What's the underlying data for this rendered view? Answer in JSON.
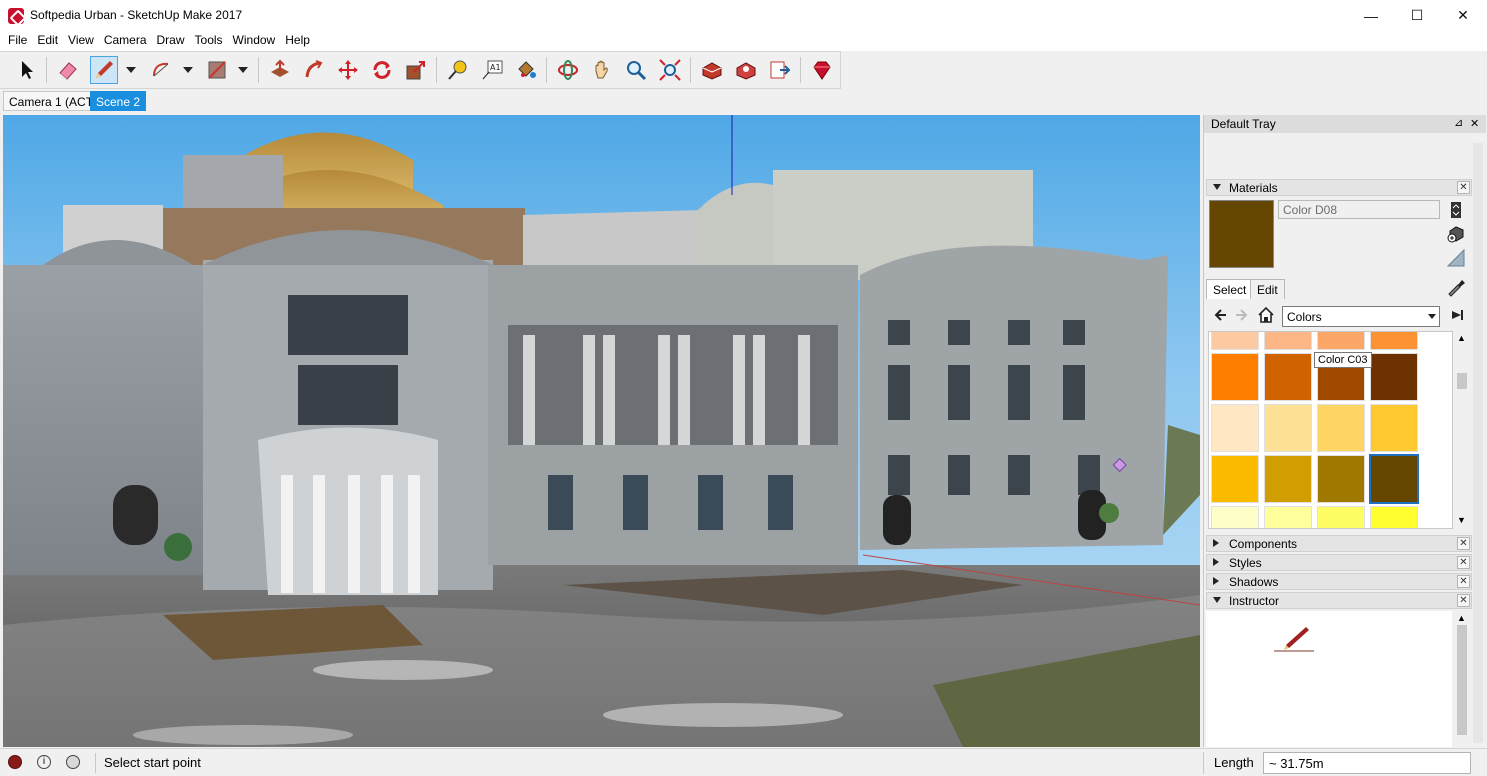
{
  "window": {
    "title": "Softpedia Urban - SketchUp Make 2017",
    "minimize": "—",
    "maximize": "☐",
    "close": "✕"
  },
  "menu": [
    "File",
    "Edit",
    "View",
    "Camera",
    "Draw",
    "Tools",
    "Window",
    "Help"
  ],
  "scenes": [
    {
      "label": "Camera 1 (ACT)",
      "active": false
    },
    {
      "label": "Scene 2",
      "active": true
    }
  ],
  "tray": {
    "title": "Default Tray",
    "pin": "⊿",
    "close": "✕",
    "materials": {
      "heading": "Materials",
      "current_name": "Color D08",
      "current_color": "#644600",
      "tabs": [
        "Select",
        "Edit"
      ],
      "library": "Colors",
      "tooltip": "Color C03",
      "swatches": [
        [
          "#fcc9a0",
          "#fdb787",
          "#fca767",
          "#fb9233"
        ],
        [
          "#fe7f00",
          "#d06300",
          "#a04a00",
          "#6e3100"
        ],
        [
          "#fee7c2",
          "#fde295",
          "#fed564",
          "#fec931"
        ],
        [
          "#fdbb00",
          "#d09e00",
          "#a17900",
          "#644600"
        ],
        [
          "#fefec8",
          "#fefe9b",
          "#fefe64",
          "#fefe31"
        ]
      ]
    },
    "panels": [
      "Components",
      "Styles",
      "Shadows",
      "Instructor"
    ]
  },
  "status": {
    "hint": "Select start point",
    "length_label": "Length",
    "length_value": "~ 31.75m"
  }
}
